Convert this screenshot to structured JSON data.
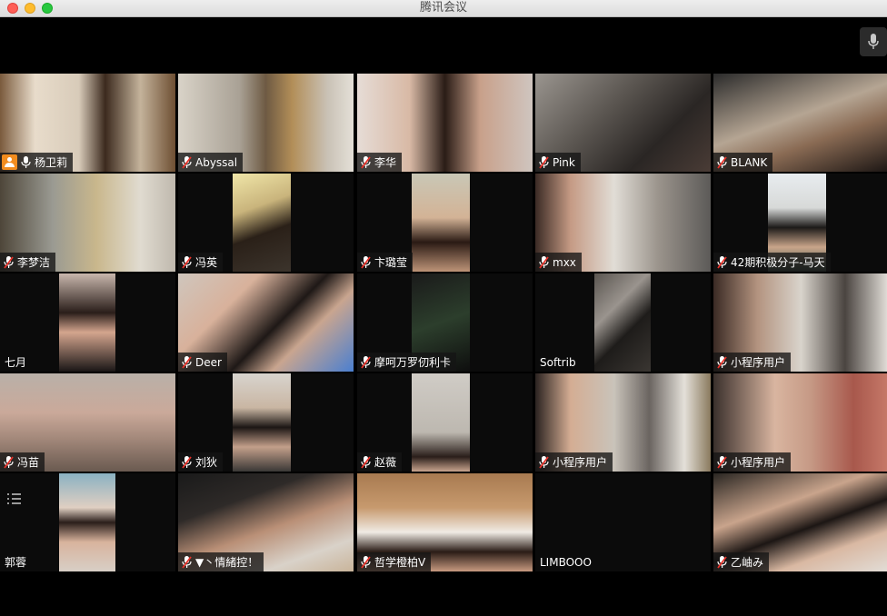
{
  "window": {
    "title": "腾讯会议"
  },
  "colors": {
    "active_border": "#2fbd5b",
    "host_badge": "#f28c1e",
    "muted_mic": "#e8322a"
  },
  "participants": [
    {
      "name": "杨卫莉",
      "muted": false,
      "host": true,
      "active": true,
      "video": "full",
      "bg": "linear-gradient(90deg,#7a5a3c 0%,#e8dccb 20%,#d8cbb9 45%,#3c2a1e 60%,#c4b39b 80%,#6e4f33 100%)"
    },
    {
      "name": "Abyssal",
      "muted": true,
      "video": "full",
      "bg": "linear-gradient(90deg,#d9d3c8 0%,#a9a195 35%,#6e5a43 50%,#b28e58 65%,#c9c1b5 85%,#e4e0d8 100%)"
    },
    {
      "name": "李华",
      "muted": true,
      "video": "full",
      "bg": "linear-gradient(90deg,#e6dcd6 0%,#d8b9a5 30%,#2a1c16 50%,#c8a08a 70%,#cfc5bf 100%)"
    },
    {
      "name": "Pink",
      "muted": true,
      "video": "full",
      "bg": "linear-gradient(135deg,#9a958f 0%,#5a5550 40%,#2a2624 70%,#4a3c36 100%)"
    },
    {
      "name": "BLANK",
      "muted": true,
      "video": "full",
      "bg": "linear-gradient(160deg,#2b2b2b 0%,#b5a593 45%,#8a6b54 65%,#1c1614 100%)"
    },
    {
      "name": "李梦洁",
      "muted": true,
      "video": "full",
      "bg": "linear-gradient(90deg,#4e4639 0%,#9a9a92 30%,#c9b78c 55%,#e0dbd0 80%,#bfb8ad 100%)"
    },
    {
      "name": "冯英",
      "muted": true,
      "video": "mid",
      "bg": "linear-gradient(160deg,#f0e6a8 0%,#c9b47c 35%,#2a2018 60%,#3c342c 100%)"
    },
    {
      "name": "卞璐莹",
      "muted": true,
      "video": "mid",
      "bg": "linear-gradient(180deg,#c9c7b6 0%,#d3b396 45%,#2a1a14 70%,#bd9478 100%)"
    },
    {
      "name": "mxx",
      "muted": true,
      "video": "full",
      "bg": "linear-gradient(90deg,#3a2a24 0%,#c59a84 20%,#e1ddd6 45%,#9b948c 70%,#5c5a58 100%)"
    },
    {
      "name": "42期积极分子-马天",
      "muted": true,
      "video": "mid",
      "bg": "linear-gradient(180deg,#e8ecef 0%,#d7d9d8 35%,#1c1a18 55%,#c9a58a 75%,#3a4e44 100%)"
    },
    {
      "name": "七月",
      "muted": false,
      "plain": true,
      "video": "left",
      "bg": "linear-gradient(180deg,#c9b7ad 0%,#2a1e1a 40%,#d4a58e 60%,#1a1616 100%)"
    },
    {
      "name": "Deer",
      "muted": true,
      "video": "full",
      "bg": "linear-gradient(135deg,#cfc6bd 0%,#d8b19b 30%,#1e1816 55%,#c9a58f 70%,#4a7fd0 100%)"
    },
    {
      "name": "摩呵万罗仞利卡",
      "muted": true,
      "video": "mid",
      "bg": "linear-gradient(160deg,#1a1a1a 0%,#2c3e2c 50%,#0e0e0e 100%)"
    },
    {
      "name": "Softrib",
      "muted": false,
      "plain": true,
      "video": "left",
      "bg": "linear-gradient(135deg,#5a5550 0%,#9a948e 35%,#1e1c1a 60%,#3a3632 100%)"
    },
    {
      "name": "小程序用户",
      "muted": true,
      "video": "full",
      "bg": "linear-gradient(90deg,#3a2a24 0%,#b3937f 25%,#d9d4cc 50%,#4a4440 75%,#e6e2dc 100%)"
    },
    {
      "name": "冯苗",
      "muted": true,
      "video": "full",
      "bg": "linear-gradient(180deg,#b9b0a8 0%,#caa99a 40%,#a58a7c 65%,#6a5a50 100%)"
    },
    {
      "name": "刘狄",
      "muted": true,
      "video": "mid",
      "bg": "linear-gradient(180deg,#d8d4ce 0%,#c9b6a3 35%,#1c1614 55%,#c39f8a 75%,#3a3836 100%)"
    },
    {
      "name": "赵薇",
      "muted": true,
      "video": "mid",
      "bg": "linear-gradient(180deg,#d0ccc6 0%,#bdb8b0 60%,#2a1e1a 85%,#c9a58f 100%)"
    },
    {
      "name": "小程序用户",
      "muted": true,
      "video": "full",
      "bg": "linear-gradient(90deg,#2a2220 0%,#d4ad93 20%,#c9c3ba 45%,#6a6460 65%,#e4e0d9 85%,#8a7a5e 100%)"
    },
    {
      "name": "小程序用户",
      "muted": true,
      "video": "full",
      "bg": "linear-gradient(90deg,#3a302c 0%,#d9b5a0 35%,#c69a86 55%,#a8584c 80%,#c77a6a 100%)"
    },
    {
      "name": "郭蓉",
      "muted": false,
      "plain": true,
      "video": "left",
      "menu": true,
      "bg": "linear-gradient(180deg,#8ab1c2 0%,#e0cfc2 35%,#2a1e1a 50%,#d8b39d 70%,#d8cfc6 100%)"
    },
    {
      "name": "▼丶情緒控！",
      "muted": true,
      "video": "full",
      "bg": "linear-gradient(160deg,#1a1a1a 0%,#2e2a28 30%,#b98f76 55%,#d9d2c9 80%,#c9b49a 100%)"
    },
    {
      "name": "哲学橙柏V",
      "muted": true,
      "video": "full",
      "bg": "linear-gradient(180deg,#a87a50 0%,#c79a6e 35%,#f0ebe4 60%,#2a1c16 80%,#c89a80 100%)"
    },
    {
      "name": "LIMBOOO",
      "muted": false,
      "plain": true,
      "video": "none",
      "bg": "#0b0b0b"
    },
    {
      "name": "乙岫み",
      "muted": true,
      "video": "full",
      "bg": "linear-gradient(160deg,#2a2622 0%,#c9a48c 35%,#1c1614 55%,#d9b8a2 75%,#e2ddd7 100%)"
    }
  ]
}
